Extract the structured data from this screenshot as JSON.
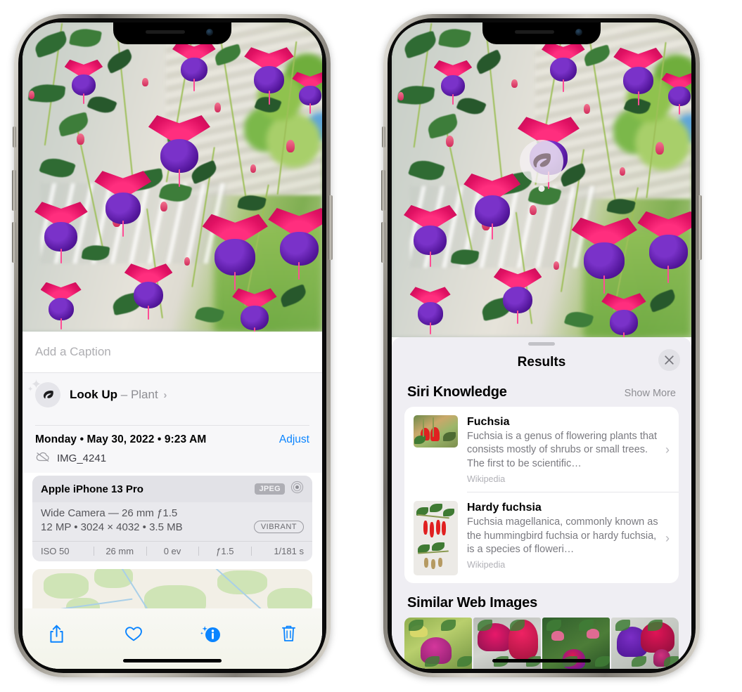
{
  "left_phone": {
    "name": "iPhone showing Photos app info view",
    "caption_placeholder": "Add a Caption",
    "lookup": {
      "label": "Look Up",
      "separator": "–",
      "subject": "Plant",
      "chevron": "›",
      "icon": "leaf-icon"
    },
    "metadata": {
      "date_line": "Monday • May 30, 2022 • 9:23 AM",
      "adjust_label": "Adjust",
      "filename": "IMG_4241",
      "cloud_icon": "icloud-slash-icon"
    },
    "exif": {
      "device": "Apple iPhone 13 Pro",
      "format_badge": "JPEG",
      "raw_icon": "aperture-icon",
      "lens_line": "Wide Camera — 26 mm ƒ1.5",
      "specs_line": "12 MP • 3024 × 4032 • 3.5 MB",
      "style_badge": "VIBRANT",
      "stats": [
        "ISO 50",
        "26 mm",
        "0 ev",
        "ƒ1.5",
        "1/181 s"
      ]
    },
    "toolbar": [
      {
        "name": "share-button",
        "icon": "share-icon"
      },
      {
        "name": "favorite-button",
        "icon": "heart-icon"
      },
      {
        "name": "info-button",
        "icon": "info-sparkle-icon"
      },
      {
        "name": "delete-button",
        "icon": "trash-icon"
      }
    ],
    "accent_color": "#0a84ff"
  },
  "right_phone": {
    "name": "iPhone showing Visual Look Up results",
    "photo_pin": {
      "icon": "leaf-icon",
      "label": "Visual Look Up plant badge"
    },
    "sheet": {
      "title": "Results",
      "close_icon": "close-icon",
      "siri_section": {
        "heading": "Siri Knowledge",
        "show_more": "Show More",
        "cards": [
          {
            "title": "Fuchsia",
            "description": "Fuchsia is a genus of flowering plants that consists mostly of shrubs or small trees. The first to be scientific…",
            "source": "Wikipedia",
            "thumbnail": "red-fuchsia-flowers-photo",
            "chevron": "›"
          },
          {
            "title": "Hardy fuchsia",
            "description": "Fuchsia magellanica, commonly known as the hummingbird fuchsia or hardy fuchsia, is a species of floweri…",
            "source": "Wikipedia",
            "thumbnail": "hardy-fuchsia-specimen-photo",
            "chevron": "›"
          }
        ]
      },
      "web_section": {
        "heading": "Similar Web Images",
        "images": [
          {
            "name": "web-image-1",
            "alt": "pink and magenta fuchsia with green leaves"
          },
          {
            "name": "web-image-2",
            "alt": "red fuchsia blossoms close up"
          },
          {
            "name": "web-image-3",
            "alt": "fuchsia bush with buds"
          },
          {
            "name": "web-image-4",
            "alt": "purple and red double fuchsia"
          }
        ]
      }
    }
  }
}
